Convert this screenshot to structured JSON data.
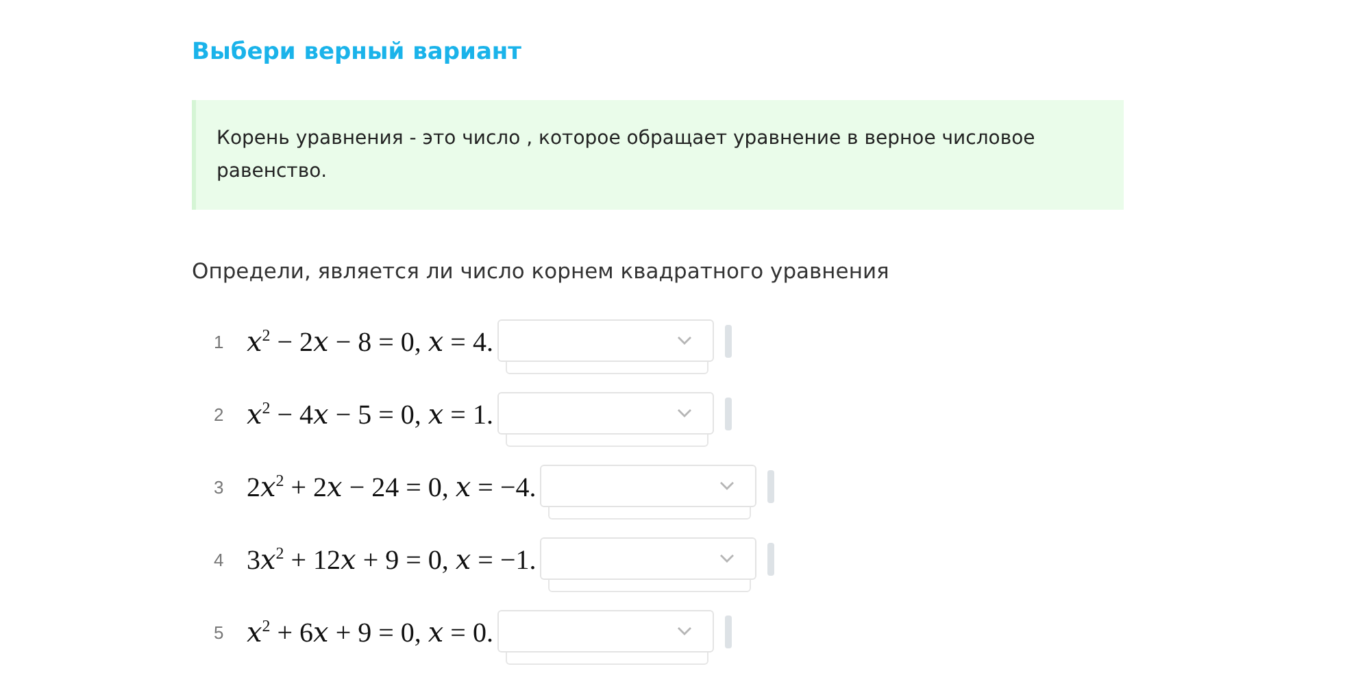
{
  "title": "Выбери верный вариант",
  "hint": "Корень уравнения - это число , которое обращает уравнение в верное числовое равенство.",
  "question": "Определи, является ли число корнем квадратного уравнения",
  "items": [
    {
      "number": "1",
      "equation": "𝑥$^{2}$ − 2𝑥 − 8 = 0, 𝑥 = 4."
    },
    {
      "number": "2",
      "equation": "𝑥$^{2}$ − 4𝑥 − 5 = 0, 𝑥 = 1."
    },
    {
      "number": "3",
      "equation": "2𝑥$^{2}$ + 2𝑥 − 24 = 0, 𝑥 = −4."
    },
    {
      "number": "4",
      "equation": "3𝑥$^{2}$ + 12𝑥 + 9 = 0, 𝑥 = −1."
    },
    {
      "number": "5",
      "equation": "𝑥$^{2}$ + 6𝑥 + 9 = 0, 𝑥 = 0."
    }
  ]
}
